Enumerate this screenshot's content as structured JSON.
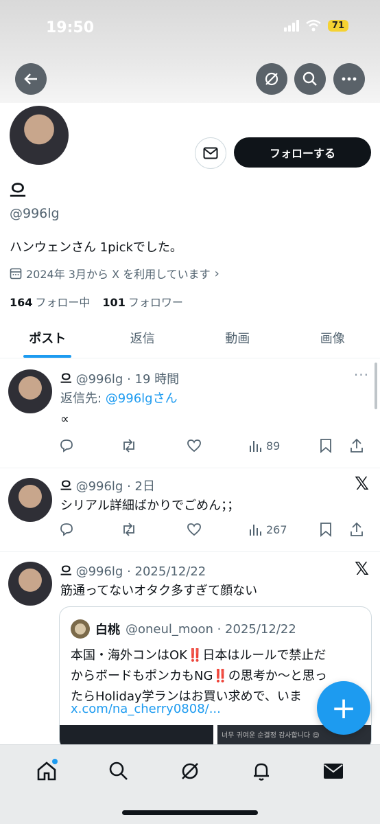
{
  "status": {
    "time": "19:50",
    "battery": "71"
  },
  "profile": {
    "name": "으",
    "handle": "@996lg",
    "bio": "ハンウェンさん 1pickでした。",
    "joined": "2024年 3月から X を利用しています",
    "following_count": "164",
    "following_label": "フォロー中",
    "followers_count": "101",
    "followers_label": "フォロワー",
    "follow_label": "フォローする"
  },
  "tabs": [
    {
      "label": "ポスト",
      "active": true
    },
    {
      "label": "返信"
    },
    {
      "label": "動画"
    },
    {
      "label": "画像"
    }
  ],
  "posts": [
    {
      "name": "으",
      "meta": "@996lg · 19 時間",
      "reply_prefix": "返信先: ",
      "reply_link": "@996lgさん",
      "text": "∝",
      "views": "89"
    },
    {
      "name": "으",
      "meta": "@996lg · 2日",
      "text": "シリアル詳細ばかりでごめん；；",
      "views": "267"
    },
    {
      "name": "으",
      "meta": "@996lg · 2025/12/22",
      "text": "筋通ってないオタク多すぎて顔ない",
      "quote": {
        "name": "白桃",
        "meta": "@oneul_moon · 2025/12/22",
        "line1": "本国・海外コンはOK‼️日本はルールで禁止だ",
        "line2": "からボードもポンカもNG‼️の思考か〜と思っ",
        "line3": "たらHoliday学ランはお買い求めで、いま",
        "link": "x.com/na_cherry0808/...",
        "image_text": "너무 귀여운 순결정 감사합니다 😌"
      }
    }
  ],
  "icons": {
    "back": "arrow-left-icon",
    "grok": "grok-icon",
    "search": "search-icon",
    "more": "more-icon",
    "message": "envelope-icon",
    "calendar": "calendar-icon",
    "reply": "reply-icon",
    "repost": "repost-icon",
    "like": "heart-icon",
    "views": "views-icon",
    "bookmark": "bookmark-icon",
    "share": "share-icon",
    "x_logo": "x-logo-icon",
    "compose": "plus-icon"
  },
  "colors": {
    "accent": "#1d9bf0",
    "text": "#0f1419",
    "secondary": "#536471"
  }
}
